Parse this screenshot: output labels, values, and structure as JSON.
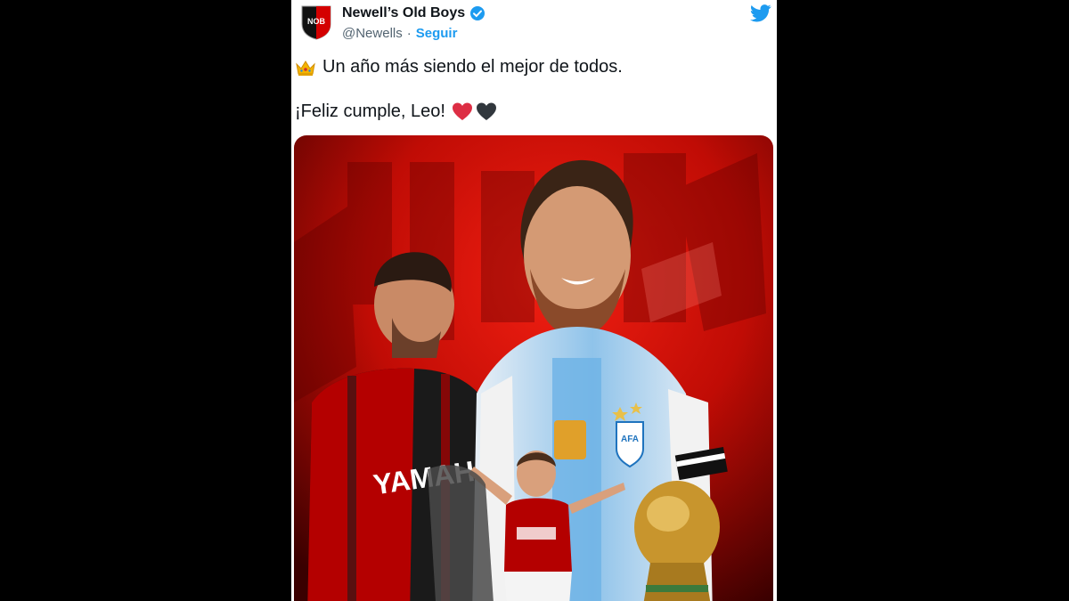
{
  "account": {
    "avatar_text": "NOB",
    "name": "Newell’s Old Boys",
    "handle": "@Newells",
    "separator": "·",
    "follow_label": "Seguir"
  },
  "tweet": {
    "line1_emoji": "crown-emoji",
    "line1": "Un año más siendo el mejor de todos.",
    "line2": "¡Feliz cumple, Leo!",
    "line2_emojis": [
      "red-heart-emoji",
      "black-heart-emoji"
    ]
  },
  "media": {
    "description_icon": "photo",
    "jersey_text": "YAMAHA",
    "badge_text": "AFA"
  },
  "colors": {
    "accent": "#1d9bf0",
    "club_red": "#d40000",
    "club_black": "#111111"
  }
}
